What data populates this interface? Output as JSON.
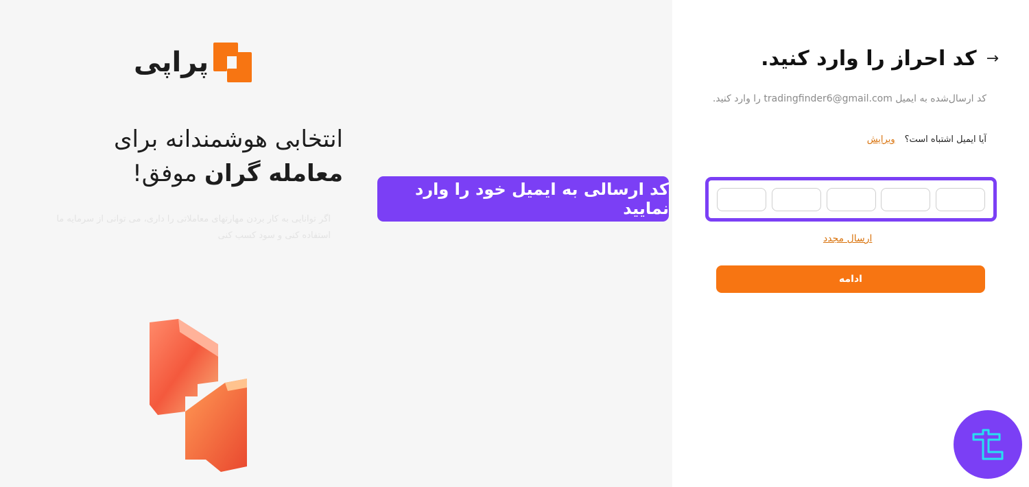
{
  "brand": {
    "name": "پراپی",
    "accent": "#f77512"
  },
  "hero": {
    "line1": "انتخابی هوشمندانه برای",
    "line2_bold": "معامله گران",
    "line2_rest": " موفق!",
    "sub": "اگر توانایی به کار بردن مهارتهای معاملاتی را داری، می توانی از سرمایه ما استفاده کنی و سود کسب کنی"
  },
  "callout": {
    "text": "کد ارسالی به ایمیل خود را وارد نمایید",
    "color": "#7b3ff5"
  },
  "form": {
    "back_icon": "arrow-right-icon",
    "title": "کد احراز را وارد کنید.",
    "description": "کد ارسال‌شده به ایمیل tradingfinder6@gmail.com را وارد کنید.",
    "wrong_email_question": "آیا ایمیل اشتباه است؟",
    "edit_label": "ویرایش",
    "otp_cells": [
      "",
      "",
      "",
      "",
      ""
    ],
    "resend_label": "ارسال مجدد",
    "continue_label": "ادامه"
  },
  "badge": {
    "icon": "tradingfinder-logo-icon"
  }
}
